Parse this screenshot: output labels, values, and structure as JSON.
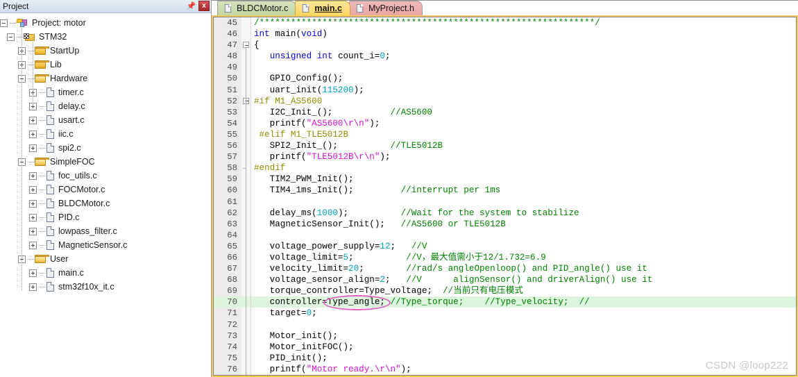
{
  "panel": {
    "title": "Project",
    "pin_icon": "pin-icon",
    "close_label": "x",
    "tree": [
      {
        "label": "Project: motor",
        "depth": 0,
        "icon": "project-icon",
        "state": "expanded"
      },
      {
        "label": "STM32",
        "depth": 1,
        "icon": "target-icon",
        "state": "expanded"
      },
      {
        "label": "StartUp",
        "depth": 2,
        "icon": "folder-icon",
        "state": "collapsed"
      },
      {
        "label": "Lib",
        "depth": 2,
        "icon": "folder-icon",
        "state": "collapsed"
      },
      {
        "label": "Hardware",
        "depth": 2,
        "icon": "folder-open-icon",
        "state": "expanded"
      },
      {
        "label": "timer.c",
        "depth": 3,
        "icon": "file-icon",
        "state": "collapsed"
      },
      {
        "label": "delay.c",
        "depth": 3,
        "icon": "file-icon",
        "state": "collapsed"
      },
      {
        "label": "usart.c",
        "depth": 3,
        "icon": "file-icon",
        "state": "collapsed"
      },
      {
        "label": "iic.c",
        "depth": 3,
        "icon": "file-icon",
        "state": "collapsed"
      },
      {
        "label": "spi2.c",
        "depth": 3,
        "icon": "file-icon",
        "state": "collapsed"
      },
      {
        "label": "SimpleFOC",
        "depth": 2,
        "icon": "folder-open-icon",
        "state": "expanded"
      },
      {
        "label": "foc_utils.c",
        "depth": 3,
        "icon": "file-icon",
        "state": "collapsed"
      },
      {
        "label": "FOCMotor.c",
        "depth": 3,
        "icon": "file-icon",
        "state": "collapsed"
      },
      {
        "label": "BLDCMotor.c",
        "depth": 3,
        "icon": "file-icon",
        "state": "collapsed"
      },
      {
        "label": "PID.c",
        "depth": 3,
        "icon": "file-icon",
        "state": "collapsed"
      },
      {
        "label": "lowpass_filter.c",
        "depth": 3,
        "icon": "file-icon",
        "state": "collapsed"
      },
      {
        "label": "MagneticSensor.c",
        "depth": 3,
        "icon": "file-icon",
        "state": "collapsed"
      },
      {
        "label": "User",
        "depth": 2,
        "icon": "folder-open-icon",
        "state": "expanded"
      },
      {
        "label": "main.c",
        "depth": 3,
        "icon": "file-icon",
        "state": "collapsed"
      },
      {
        "label": "stm32f10x_it.c",
        "depth": 3,
        "icon": "file-icon",
        "state": "collapsed"
      }
    ]
  },
  "tabs": [
    {
      "label": "BLDCMotor.c",
      "color": "green",
      "active": false
    },
    {
      "label": "main.c",
      "color": "yellow",
      "active": true
    },
    {
      "label": "MyProject.h",
      "color": "pink",
      "active": false
    }
  ],
  "editor": {
    "first_line": 45,
    "highlight_line": 70,
    "folds": [
      {
        "line": 47,
        "type": "box"
      },
      {
        "line": 52,
        "type": "box"
      },
      {
        "line": 58,
        "type": "end"
      }
    ],
    "lines": [
      {
        "n": 45,
        "tokens": [
          {
            "t": "/****************************************************************/",
            "c": "cmt"
          }
        ]
      },
      {
        "n": 46,
        "tokens": [
          {
            "t": "int ",
            "c": "kw"
          },
          {
            "t": "main(",
            "c": "plain"
          },
          {
            "t": "void",
            "c": "kw"
          },
          {
            "t": ")",
            "c": "plain"
          }
        ]
      },
      {
        "n": 47,
        "tokens": [
          {
            "t": "{",
            "c": "plain"
          }
        ]
      },
      {
        "n": 48,
        "tokens": [
          {
            "t": "   ",
            "c": "plain"
          },
          {
            "t": "unsigned int ",
            "c": "kw"
          },
          {
            "t": "count_i=",
            "c": "plain"
          },
          {
            "t": "0",
            "c": "num"
          },
          {
            "t": ";",
            "c": "plain"
          }
        ]
      },
      {
        "n": 49,
        "tokens": []
      },
      {
        "n": 50,
        "tokens": [
          {
            "t": "   GPIO_Config();",
            "c": "plain"
          }
        ]
      },
      {
        "n": 51,
        "tokens": [
          {
            "t": "   uart_init(",
            "c": "plain"
          },
          {
            "t": "115200",
            "c": "num"
          },
          {
            "t": ");",
            "c": "plain"
          }
        ]
      },
      {
        "n": 52,
        "tokens": [
          {
            "t": "#if M1_AS5600",
            "c": "pp"
          }
        ]
      },
      {
        "n": 53,
        "tokens": [
          {
            "t": "   I2C_Init_();",
            "c": "plain"
          },
          {
            "t": "           //AS5600",
            "c": "cmt"
          }
        ]
      },
      {
        "n": 54,
        "tokens": [
          {
            "t": "   printf(",
            "c": "plain"
          },
          {
            "t": "\"AS5600\\r\\n\"",
            "c": "str"
          },
          {
            "t": ");",
            "c": "plain"
          }
        ]
      },
      {
        "n": 55,
        "tokens": [
          {
            "t": " #elif M1_TLE5012B",
            "c": "pp"
          }
        ]
      },
      {
        "n": 56,
        "tokens": [
          {
            "t": "   SPI2_Init_();",
            "c": "plain"
          },
          {
            "t": "          //TLE5012B",
            "c": "cmt"
          }
        ]
      },
      {
        "n": 57,
        "tokens": [
          {
            "t": "   printf(",
            "c": "plain"
          },
          {
            "t": "\"TLE5012B\\r\\n\"",
            "c": "str"
          },
          {
            "t": ");",
            "c": "plain"
          }
        ]
      },
      {
        "n": 58,
        "tokens": [
          {
            "t": "#endif",
            "c": "pp"
          }
        ]
      },
      {
        "n": 59,
        "tokens": [
          {
            "t": "   TIM2_PWM_Init();",
            "c": "plain"
          }
        ]
      },
      {
        "n": 60,
        "tokens": [
          {
            "t": "   TIM4_1ms_Init();",
            "c": "plain"
          },
          {
            "t": "         //interrupt per 1ms",
            "c": "cmt"
          }
        ]
      },
      {
        "n": 61,
        "tokens": []
      },
      {
        "n": 62,
        "tokens": [
          {
            "t": "   delay_ms(",
            "c": "plain"
          },
          {
            "t": "1000",
            "c": "num"
          },
          {
            "t": ");",
            "c": "plain"
          },
          {
            "t": "          //Wait for the system to stabilize",
            "c": "cmt"
          }
        ]
      },
      {
        "n": 63,
        "tokens": [
          {
            "t": "   MagneticSensor_Init();",
            "c": "plain"
          },
          {
            "t": "   //AS5600 or TLE5012B",
            "c": "cmt"
          }
        ]
      },
      {
        "n": 64,
        "tokens": []
      },
      {
        "n": 65,
        "tokens": [
          {
            "t": "   voltage_power_supply=",
            "c": "plain"
          },
          {
            "t": "12",
            "c": "num"
          },
          {
            "t": ";",
            "c": "plain"
          },
          {
            "t": "   //V",
            "c": "cmt"
          }
        ]
      },
      {
        "n": 66,
        "tokens": [
          {
            "t": "   voltage_limit=",
            "c": "plain"
          },
          {
            "t": "5",
            "c": "num"
          },
          {
            "t": ";",
            "c": "plain"
          },
          {
            "t": "          //V，最大值需小于12/1.732=6.9",
            "c": "cmt"
          }
        ]
      },
      {
        "n": 67,
        "tokens": [
          {
            "t": "   velocity_limit=",
            "c": "plain"
          },
          {
            "t": "20",
            "c": "num"
          },
          {
            "t": ";",
            "c": "plain"
          },
          {
            "t": "        //rad/s angleOpenloop() and PID_angle() use it",
            "c": "cmt"
          }
        ]
      },
      {
        "n": 68,
        "tokens": [
          {
            "t": "   voltage_sensor_align=",
            "c": "plain"
          },
          {
            "t": "2",
            "c": "num"
          },
          {
            "t": ";",
            "c": "plain"
          },
          {
            "t": "   //V      alignSensor() and driverAlign() use it",
            "c": "cmt"
          }
        ]
      },
      {
        "n": 69,
        "tokens": [
          {
            "t": "   torque_controller=Type_voltage;",
            "c": "plain"
          },
          {
            "t": "  //当前只有电压模式",
            "c": "cmt"
          }
        ]
      },
      {
        "n": 70,
        "tokens": [
          {
            "t": "   controller=Type_angle;",
            "c": "plain"
          },
          {
            "t": " //Type_torque;    //Type_velocity;  //",
            "c": "cmt"
          }
        ]
      },
      {
        "n": 71,
        "tokens": [
          {
            "t": "   target=",
            "c": "plain"
          },
          {
            "t": "0",
            "c": "num"
          },
          {
            "t": ";",
            "c": "plain"
          }
        ]
      },
      {
        "n": 72,
        "tokens": []
      },
      {
        "n": 73,
        "tokens": [
          {
            "t": "   Motor_init();",
            "c": "plain"
          }
        ]
      },
      {
        "n": 74,
        "tokens": [
          {
            "t": "   Motor_initFOC();",
            "c": "plain"
          }
        ]
      },
      {
        "n": 75,
        "tokens": [
          {
            "t": "   PID_init();",
            "c": "plain"
          }
        ]
      },
      {
        "n": 76,
        "tokens": [
          {
            "t": "   printf(",
            "c": "plain"
          },
          {
            "t": "\"Motor ready.\\r\\n\"",
            "c": "str"
          },
          {
            "t": ");",
            "c": "plain"
          }
        ]
      }
    ]
  },
  "annotation": {
    "shape": "ellipse",
    "color": "#e060c8",
    "target_text": "Type_angle;"
  },
  "watermark": "CSDN @loop222",
  "colors": {
    "keyword": "#0000e0",
    "number": "#00a0c0",
    "string": "#d010d0",
    "comment": "#008000",
    "preprocessor": "#8f8f00",
    "highlight_row": "#ddf4dd",
    "annotation": "#e060c8",
    "tab_active": "#fdd762"
  }
}
